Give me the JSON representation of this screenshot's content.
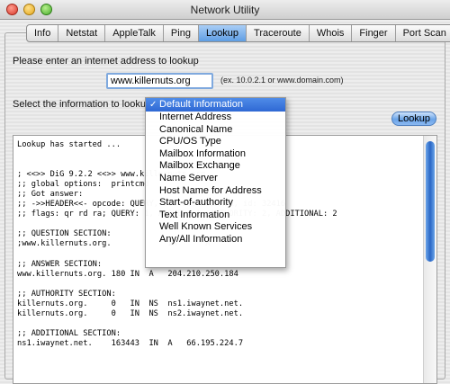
{
  "window": {
    "title": "Network Utility"
  },
  "tabs": [
    "Info",
    "Netstat",
    "AppleTalk",
    "Ping",
    "Lookup",
    "Traceroute",
    "Whois",
    "Finger",
    "Port Scan"
  ],
  "active_tab": "Lookup",
  "lookup": {
    "address_prompt": "Please enter an internet address to lookup",
    "address_value": "www.killernuts.org",
    "address_hint": "(ex. 10.0.2.1 or www.domain.com)",
    "info_prompt": "Select the information to lookup:",
    "button_label": "Lookup"
  },
  "dropdown": {
    "selected": "Default Information",
    "check_glyph": "✓",
    "options": [
      "Default Information",
      "Internet Address",
      "Canonical Name",
      "CPU/OS Type",
      "Mailbox Information",
      "Mailbox Exchange",
      "Name Server",
      "Host Name for Address",
      "Start-of-authority",
      "Text Information",
      "Well Known Services",
      "Any/All Information"
    ]
  },
  "output": {
    "text": "Lookup has started ...\n\n\n; <<>> DiG 9.2.2 <<>> www.killernuts.org\n;; global options:  printcmd\n;; Got answer:\n;; ->>HEADER<<- opcode: QUERY, status: NOERROR, id: 32416\n;; flags: qr rd ra; QUERY: 1, ANSWER: 1, AUTHORITY: 2, ADDITIONAL: 2\n\n;; QUESTION SECTION:\n;www.killernuts.org.            IN      A\n\n;; ANSWER SECTION:\nwww.killernuts.org. 180 IN  A   204.210.250.184\n\n;; AUTHORITY SECTION:\nkillernuts.org.     0   IN  NS  ns1.iwaynet.net.\nkillernuts.org.     0   IN  NS  ns2.iwaynet.net.\n\n;; ADDITIONAL SECTION:\nns1.iwaynet.net.    163443  IN  A   66.195.224.7"
  }
}
